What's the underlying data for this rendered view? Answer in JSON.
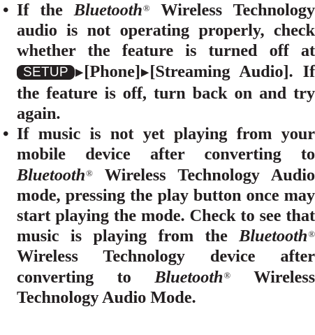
{
  "bullets": [
    {
      "marker": "•",
      "p1_prefix": "If the ",
      "p1_brand": "Bluetooth",
      "p1_reg": "®",
      "p1_text": " Wireless Technology audio is not operating properly, check whether the feature is turned off at ",
      "p1_key": "SETUP",
      "p1_arrow1": "▶",
      "p1_path1": "[Phone]",
      "p1_arrow2": "▶",
      "p1_path2": "[Streaming Audio]. If the feature is off, turn back on and try again."
    },
    {
      "marker": "•",
      "p2_a": "If music is not yet playing from your mobile device after converting to ",
      "p2_brand1": "Bluetooth",
      "p2_reg1": "®",
      "p2_b": " Wireless Technology Audio mode, pressing the play button once may start playing the mode. Check to see that music is playing from the ",
      "p2_brand2": "Bluetooth",
      "p2_reg2": "®",
      "p2_c": " Wireless Technology device after converting to ",
      "p2_brand3": "Bluetooth",
      "p2_reg3": "®",
      "p2_d": " Wireless Technology Audio Mode."
    }
  ]
}
